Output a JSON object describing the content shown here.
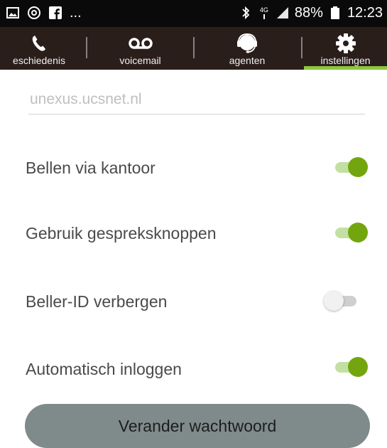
{
  "status_bar": {
    "left_icons": [
      "gallery-icon",
      "whatsapp-icon",
      "facebook-icon"
    ],
    "left_overflow": "...",
    "right_icons": [
      "bluetooth-icon",
      "network-4g-icon",
      "signal-icon"
    ],
    "network_label": "4G",
    "battery_percent": "88%",
    "battery_icon": "battery-icon",
    "time": "12:23"
  },
  "tabs": [
    {
      "label": "eschiedenis",
      "icon": "phone-icon",
      "active": false
    },
    {
      "label": "voicemail",
      "icon": "voicemail-icon",
      "active": false
    },
    {
      "label": "agenten",
      "icon": "headset-agent-icon",
      "active": false
    },
    {
      "label": "instellingen",
      "icon": "gear-icon",
      "active": true
    }
  ],
  "server": {
    "value": "unexus.ucsnet.nl"
  },
  "settings": [
    {
      "label": "Bellen via kantoor",
      "enabled": true
    },
    {
      "label": "Gebruik gespreksknoppen",
      "enabled": true
    },
    {
      "label": "Beller-ID verbergen",
      "enabled": false
    },
    {
      "label": "Automatisch inloggen",
      "enabled": true
    }
  ],
  "change_password_button": "Verander wachtwoord",
  "colors": {
    "accent": "#73a60e",
    "tab_bar": "#2a1e1b",
    "button": "#7f8b8a"
  }
}
